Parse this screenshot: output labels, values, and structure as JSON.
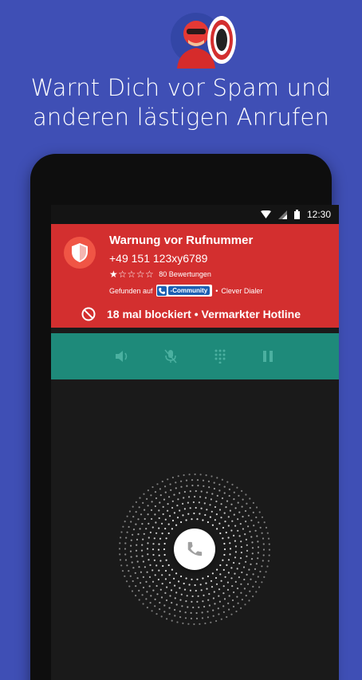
{
  "hero": {
    "headline_line1": "Warnt Dich vor Spam und",
    "headline_line2": "anderen lästigen Anrufen"
  },
  "status_bar": {
    "time": "12:30",
    "icons": [
      "wifi-icon",
      "signal-icon",
      "battery-icon"
    ]
  },
  "warning_card": {
    "title": "Warnung vor Rufnummer",
    "number": "+49 151 123xy6789",
    "rating": 1,
    "rating_max": 5,
    "stars_text": "★☆☆☆☆",
    "reviews": "80 Bewertungen",
    "found_on": "Gefunden auf",
    "community_label": "-Community",
    "separator": "•",
    "app_name": "Clever Dialer",
    "blocked_text": "18 mal blockiert • Vermarkter Hotline",
    "icon": "shield-icon"
  },
  "call_controls": [
    "speaker-icon",
    "mute-mic-icon",
    "dialpad-icon",
    "pause-icon"
  ],
  "colors": {
    "background": "#3f4fb5",
    "warning_red": "#d32f2f",
    "controls_teal": "#1e8a7a",
    "screen_dark": "#1a1a1a"
  }
}
